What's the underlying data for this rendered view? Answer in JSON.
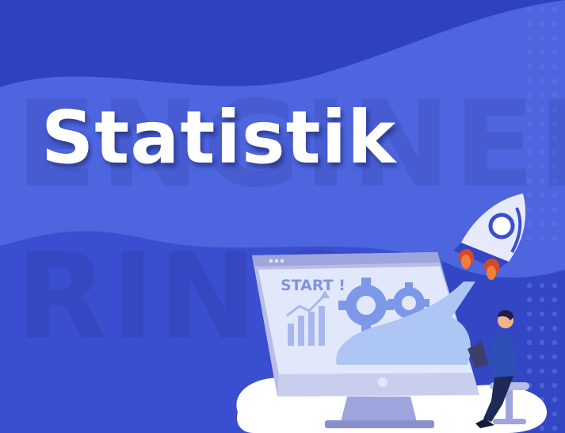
{
  "banner": {
    "title": "Statistik",
    "watermark_line1": "ENGINEE",
    "watermark_line2": "RING",
    "screen_label": "START !"
  },
  "colors": {
    "background": "#3a4fcf",
    "background_dark": "#2d3fb9",
    "wave_light": "#5572e6",
    "title": "#ffffff",
    "monitor_frame": "#b9bde6",
    "screen": "#e2e8fb",
    "accent_orange": "#f27e3a"
  }
}
